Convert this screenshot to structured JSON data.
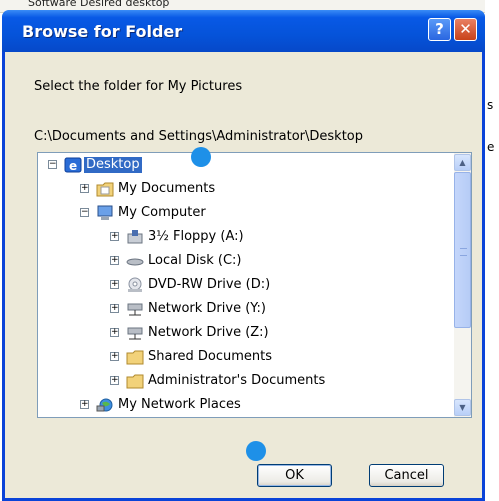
{
  "background": {
    "top_text": "Software  Desired desktop"
  },
  "dialog": {
    "title": "Browse for Folder",
    "help_glyph": "?",
    "close_glyph": "✕",
    "prompt": "Select the folder for My Pictures",
    "path": "C:\\Documents and Settings\\Administrator\\Desktop"
  },
  "tree": {
    "items": [
      {
        "label": "Desktop",
        "expander": "−",
        "icon": "desktop-icon",
        "selected": true
      },
      {
        "label": "My Documents",
        "expander": "+",
        "icon": "my-documents-icon"
      },
      {
        "label": "My Computer",
        "expander": "−",
        "icon": "my-computer-icon"
      },
      {
        "label": "3½ Floppy (A:)",
        "expander": "+",
        "icon": "floppy-drive-icon"
      },
      {
        "label": "Local Disk (C:)",
        "expander": "+",
        "icon": "local-disk-icon"
      },
      {
        "label": "DVD-RW Drive (D:)",
        "expander": "+",
        "icon": "dvd-drive-icon"
      },
      {
        "label": "Network Drive (Y:)",
        "expander": "+",
        "icon": "network-drive-icon"
      },
      {
        "label": "Network Drive (Z:)",
        "expander": "+",
        "icon": "network-drive-icon"
      },
      {
        "label": "Shared Documents",
        "expander": "+",
        "icon": "folder-icon"
      },
      {
        "label": "Administrator's Documents",
        "expander": "+",
        "icon": "folder-icon"
      },
      {
        "label": "My Network Places",
        "expander": "+",
        "icon": "network-places-icon"
      }
    ]
  },
  "buttons": {
    "ok": "OK",
    "cancel": "Cancel"
  },
  "colors": {
    "title_bar": "#0553d9",
    "selection": "#316ac5",
    "marker": "#1e90e8"
  }
}
